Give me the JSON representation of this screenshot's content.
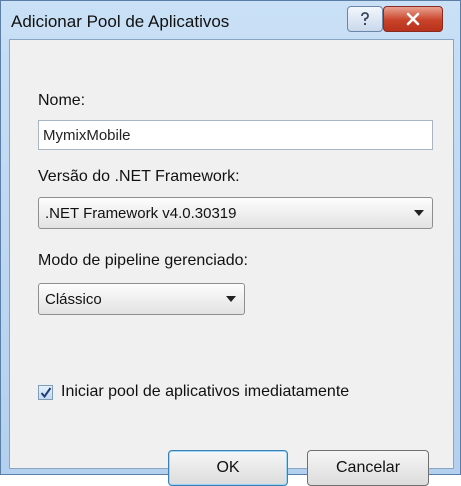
{
  "window": {
    "title": "Adicionar Pool de Aplicativos",
    "help_glyph": "?",
    "close_glyph": "X"
  },
  "form": {
    "name_label": "Nome:",
    "name_value": "MymixMobile",
    "framework_label": "Versão do .NET Framework:",
    "framework_selected": ".NET Framework v4.0.30319",
    "pipeline_label": "Modo de pipeline gerenciado:",
    "pipeline_selected": "Clássico",
    "start_checkbox_label": "Iniciar pool de aplicativos imediatamente",
    "start_checked": true
  },
  "buttons": {
    "ok_label": "OK",
    "cancel_label": "Cancelar"
  },
  "colors": {
    "titlebar": "#c9e0f6",
    "close_button": "#c9432a",
    "client_bg": "#f0f0f0"
  }
}
